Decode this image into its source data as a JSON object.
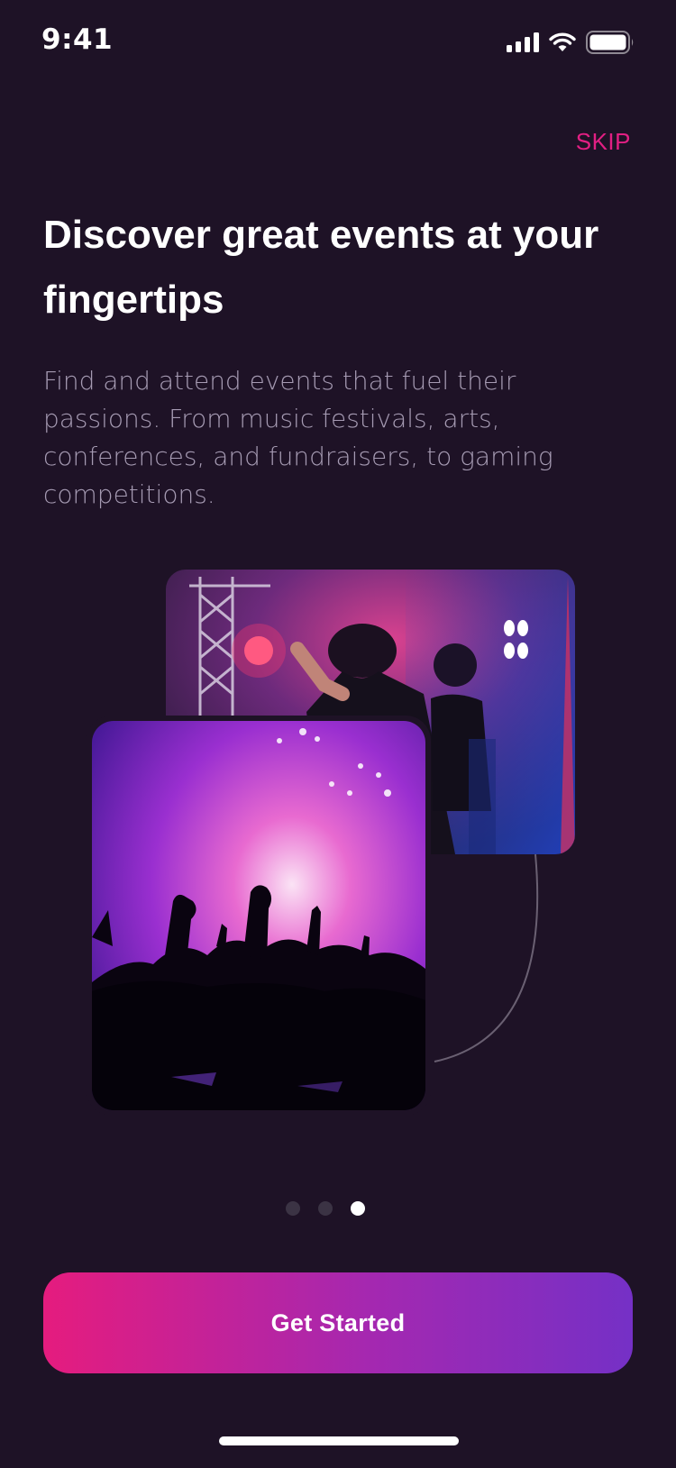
{
  "status_bar": {
    "time": "9:41",
    "signal_icon": "cellular-signal-icon",
    "wifi_icon": "wifi-icon",
    "battery_icon": "battery-icon"
  },
  "onboarding": {
    "skip_label": "SKIP",
    "title": "Discover great events at your fingertips",
    "subtitle": "Find and attend events that fuel their passions. From music festivals, arts, conferences, and fundraisers, to gaming competitions.",
    "images": [
      "concert-performers-photo",
      "concert-crowd-photo"
    ]
  },
  "pager": {
    "total": 3,
    "active_index": 3
  },
  "cta": {
    "label": "Get Started"
  },
  "colors": {
    "background": "#1e1226",
    "accent": "#e21f83",
    "gradient_start": "#e51c7e",
    "gradient_end": "#7530c6",
    "subtitle": "#a69bb3"
  }
}
